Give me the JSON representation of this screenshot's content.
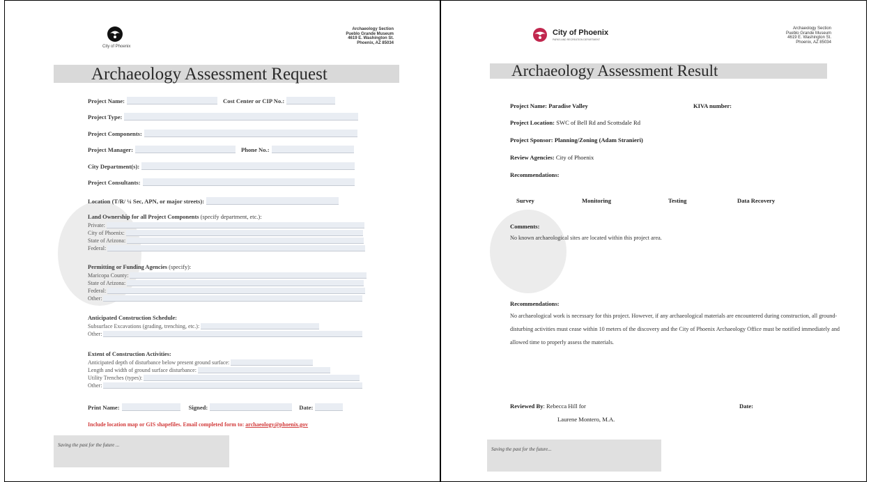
{
  "request": {
    "logo_caption": "City of Phoenix",
    "address": [
      "Archaeology Section",
      "Pueblo Grande Museum",
      "4619 E. Washington St.",
      "Phoenix, AZ 85034"
    ],
    "title": "Archaeology Assessment Request",
    "fields": {
      "project_name": "Project Name:",
      "cost_center": "Cost Center or CIP No.:",
      "project_type": "Project Type:",
      "project_components": "Project Components:",
      "project_manager": "Project Manager:",
      "phone": "Phone No.:",
      "city_departments": "City Department(s):",
      "project_consultants": "Project Consultants:",
      "location": "Location (T/R/ ¼ Sec, APN, or major streets):"
    },
    "land": {
      "heading": "Land Ownership for all Project Components",
      "heading_note": " (specify department, etc.):",
      "rows": [
        "Private:",
        "City of Phoenix:",
        "State of Arizona:",
        "Federal:"
      ]
    },
    "permitting": {
      "heading": "Permitting or Funding Agencies",
      "heading_note": " (specify):",
      "rows": [
        "Maricopa County:",
        "State of Arizona:",
        "Federal:",
        "Other:"
      ]
    },
    "schedule": {
      "heading": "Anticipated Construction Schedule:",
      "rows": [
        "Subsurface Excavations (grading, trenching, etc.):",
        "Other:"
      ]
    },
    "extent": {
      "heading": "Extent of Construction Activities:",
      "rows": [
        "Anticipated depth of disturbance below present ground surface:",
        "Length and width of ground surface disturbance:",
        "Utility Trenches (types):",
        "Other:"
      ]
    },
    "print_name": "Print Name:",
    "signed": "Signed:",
    "date": "Date:",
    "note": "Include location map or GIS shapefiles. Email completed form to: ",
    "email": "archaeology@phoenix.gov",
    "footer": "Saving the past for the future ..."
  },
  "result": {
    "org_name": "City of Phoenix",
    "org_sub": "PARKS AND RECREATION DEPARTMENT",
    "address": [
      "Archaeology Section",
      "Pueblo Grande Museum",
      "4619 E. Washington St.",
      "Phoenix, AZ 85034"
    ],
    "title": "Archaeology Assessment Result",
    "project_name_label": "Project Name:",
    "project_name_value": "Paradise Valley",
    "kiva_label": "KIVA number:",
    "location_label": "Project Location:",
    "location_value": "SWC of Bell Rd and Scottsdale Rd",
    "sponsor_label": "Project Sponsor:",
    "sponsor_value": "Planning/Zoning (Adam Stranieri)",
    "agencies_label": "Review Agencies:",
    "agencies_value": "City of Phoenix",
    "recommendations_label": "Recommendations:",
    "options": [
      "Survey",
      "Monitoring",
      "Testing",
      "Data Recovery"
    ],
    "comments_label": "Comments:",
    "comments_value": "No known archaeological sites are located within this project area.",
    "recommendations2_label": "Recommendations:",
    "recommendations_text": "No archaeological work is necessary for this project.  However, if any archaeological materials are encountered during construction, all ground-disturbing activities must cease within 10 meters of the discovery and the City of Phoenix Archaeology Office must be notified immediately and allowed time to properly assess the materials.",
    "reviewed_label": "Reviewed By",
    "reviewed_value": "Rebecca Hill   for",
    "reviewer2": "Laurene Montero, M.A.",
    "date_label": "Date:",
    "footer": "Saving the past for the future..."
  }
}
